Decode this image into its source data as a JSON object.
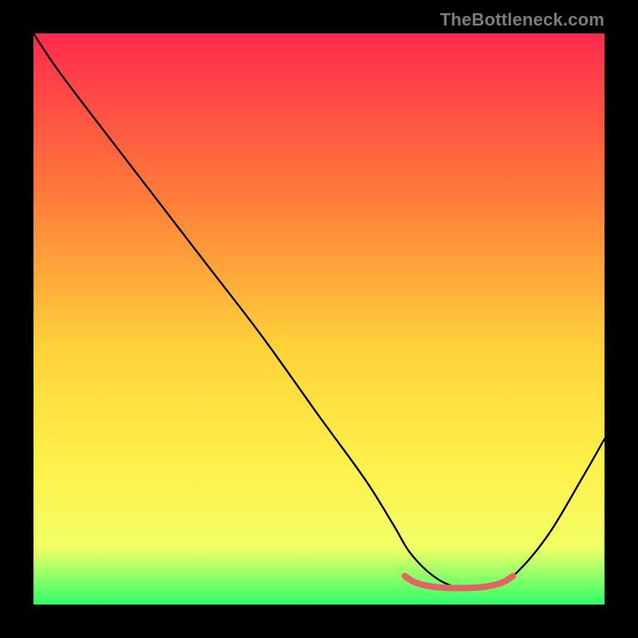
{
  "watermark": "TheBottleneck.com",
  "colors": {
    "top": "#ff2a4d",
    "mid_upper": "#ff7a3a",
    "mid": "#ffd23a",
    "mid_lower": "#fff04a",
    "low": "#f2ff66",
    "bottom": "#2fff6a",
    "curve": "#000000",
    "marker": "#e06666",
    "frame": "#000000"
  },
  "chart_data": {
    "type": "line",
    "title": "",
    "xlabel": "",
    "ylabel": "",
    "xlim": [
      0,
      100
    ],
    "ylim": [
      0,
      100
    ],
    "grid": false,
    "legend": false,
    "series": [
      {
        "name": "bottleneck-curve",
        "x": [
          0,
          4,
          10,
          20,
          30,
          40,
          50,
          58,
          63,
          66,
          70,
          74,
          77,
          80,
          84,
          90,
          96,
          100
        ],
        "y": [
          100,
          94,
          86,
          73,
          60,
          47,
          33,
          22,
          14,
          9,
          5,
          3,
          3,
          3,
          5,
          12,
          22,
          29
        ]
      },
      {
        "name": "optimal-range-marker",
        "x": [
          65,
          67,
          70,
          73,
          76,
          79,
          82,
          84
        ],
        "y": [
          5.0,
          3.8,
          3.1,
          2.9,
          2.9,
          3.1,
          3.8,
          5.0
        ]
      }
    ],
    "annotations": []
  }
}
